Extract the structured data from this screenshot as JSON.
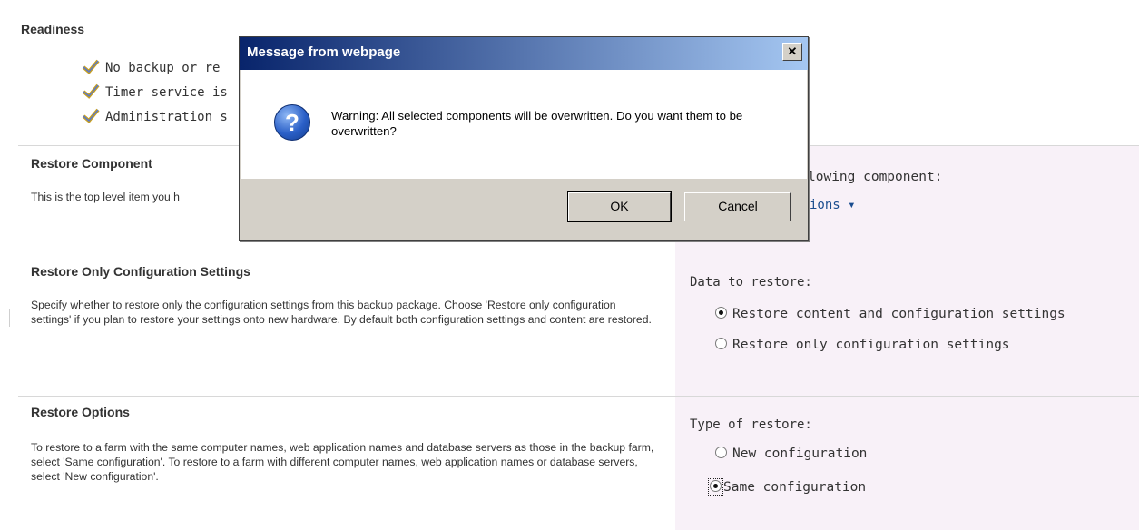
{
  "readiness": {
    "title": "Readiness",
    "items": [
      "No backup or re",
      "Timer service is",
      "Administration s"
    ]
  },
  "restore_component": {
    "heading": "Restore Component",
    "description": "This is the top level item you h",
    "right_text": "lowing component:",
    "link_text": "ions ▾"
  },
  "restore_config": {
    "heading": "Restore Only Configuration Settings",
    "description": "Specify whether to restore only the configuration settings from this backup package. Choose 'Restore only configuration settings' if you plan to restore your settings onto new hardware. By default both configuration settings and content are restored.",
    "label": "Data to restore:",
    "options": [
      {
        "label": "Restore content and configuration settings",
        "selected": true
      },
      {
        "label": "Restore only configuration settings",
        "selected": false
      }
    ]
  },
  "restore_options": {
    "heading": "Restore Options",
    "description": "To restore to a farm with the same computer names, web application names and database servers as those in the backup farm, select 'Same configuration'. To restore to a farm with different computer names, web application names or database servers, select 'New configuration'.",
    "label": "Type of restore:",
    "options": [
      {
        "label": "New configuration",
        "selected": false
      },
      {
        "label": "Same configuration",
        "selected": true
      }
    ]
  },
  "dialog": {
    "title": "Message from webpage",
    "close_glyph": "✕",
    "icon_glyph": "?",
    "message": "Warning: All selected components will be overwritten.  Do you want them to be overwritten?",
    "ok_label": "OK",
    "cancel_label": "Cancel"
  },
  "colors": {
    "title_bar_start": "#08246b",
    "title_bar_end": "#a5c7f2",
    "right_panel": "#f8f1f8",
    "link": "#1a4d8f"
  }
}
